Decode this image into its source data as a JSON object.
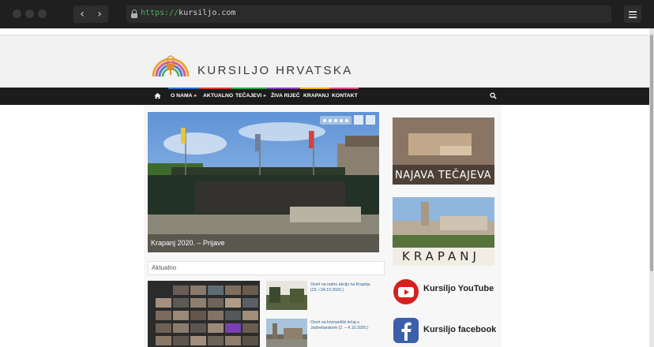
{
  "browser": {
    "url_scheme": "https://",
    "url_host": "kursiljo.com",
    "back_glyph": "‹",
    "forward_glyph": "›"
  },
  "site": {
    "brand": "KURSILJO HRVATSKA",
    "logo_text": "KURSILJO"
  },
  "nav": {
    "items": [
      {
        "label": "O NAMA »"
      },
      {
        "label": "AKTUALNO"
      },
      {
        "label": "TEČAJEVI »"
      },
      {
        "label": "ŽIVA RIJEČ"
      },
      {
        "label": "KRAPANJ"
      },
      {
        "label": "KONTAKT"
      }
    ],
    "stripe_colors": [
      "#2a6fd6",
      "#e23b2a",
      "#f0b000",
      "#2aa84a",
      "#8e3fbf",
      "#e2448c",
      "#f0b000"
    ]
  },
  "slider": {
    "caption": "Krapanj 2020. – Prijave",
    "slide_count": 5
  },
  "section": {
    "title": "Aktualno"
  },
  "news": [
    {
      "title": "Osvrt na radnu akciju na Krapnju (23. i 24.10.2020.)"
    },
    {
      "title": "Osvrt na kriznanički tečaj u Jastrebarskom (2. – 4.10.2020.)"
    }
  ],
  "sidebar": {
    "najava": "NAJAVA TEČAJEVA",
    "krapanj": "KRAPANJ",
    "youtube": "Kursiljo YouTube",
    "facebook": "Kursiljo facebook"
  }
}
